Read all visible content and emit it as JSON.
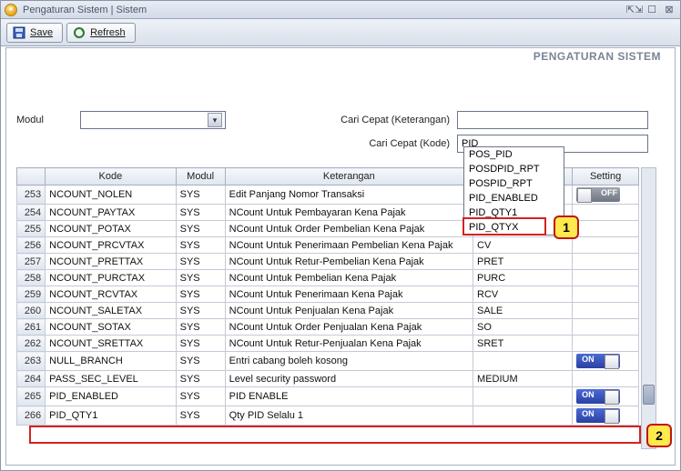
{
  "title": "Pengaturan Sistem | Sistem",
  "toolbar": {
    "save": "Save",
    "refresh": "Refresh"
  },
  "header_label": "PENGATURAN SISTEM",
  "labels": {
    "modul": "Modul",
    "cari_ket": "Cari Cepat (Keterangan)",
    "cari_kode": "Cari Cepat (Kode)"
  },
  "search": {
    "ket_value": "",
    "kode_value": "PID"
  },
  "suggestions": [
    "POS_PID",
    "POSDPID_RPT",
    "POSPID_RPT",
    "PID_ENABLED",
    "PID_QTY1",
    "PID_QTYX"
  ],
  "columns": {
    "c1": "Kode",
    "c2": "Modul",
    "c3": "Keterangan",
    "c4": "",
    "c5": "Setting"
  },
  "rows": [
    {
      "n": "253",
      "kode": "NCOUNT_NOLEN",
      "modul": "SYS",
      "ket": "Edit Panjang Nomor Transaksi",
      "val": "",
      "set": "OFF"
    },
    {
      "n": "254",
      "kode": "NCOUNT_PAYTAX",
      "modul": "SYS",
      "ket": "NCount Untuk Pembayaran Kena Pajak",
      "val": "",
      "set": ""
    },
    {
      "n": "255",
      "kode": "NCOUNT_POTAX",
      "modul": "SYS",
      "ket": "NCount Untuk Order Pembelian Kena Pajak",
      "val": "",
      "set": ""
    },
    {
      "n": "256",
      "kode": "NCOUNT_PRCVTAX",
      "modul": "SYS",
      "ket": "NCount Untuk Penerimaan Pembelian Kena Pajak",
      "val": "CV",
      "set": ""
    },
    {
      "n": "257",
      "kode": "NCOUNT_PRETTAX",
      "modul": "SYS",
      "ket": "NCount Untuk Retur-Pembelian Kena Pajak",
      "val": "PRET",
      "set": ""
    },
    {
      "n": "258",
      "kode": "NCOUNT_PURCTAX",
      "modul": "SYS",
      "ket": "NCount Untuk Pembelian Kena Pajak",
      "val": "PURC",
      "set": ""
    },
    {
      "n": "259",
      "kode": "NCOUNT_RCVTAX",
      "modul": "SYS",
      "ket": "NCount Untuk Penerimaan Kena Pajak",
      "val": "RCV",
      "set": ""
    },
    {
      "n": "260",
      "kode": "NCOUNT_SALETAX",
      "modul": "SYS",
      "ket": "NCount Untuk Penjualan Kena Pajak",
      "val": "SALE",
      "set": ""
    },
    {
      "n": "261",
      "kode": "NCOUNT_SOTAX",
      "modul": "SYS",
      "ket": "NCount Untuk Order Penjualan Kena Pajak",
      "val": "SO",
      "set": ""
    },
    {
      "n": "262",
      "kode": "NCOUNT_SRETTAX",
      "modul": "SYS",
      "ket": "NCount Untuk Retur-Penjualan Kena Pajak",
      "val": "SRET",
      "set": ""
    },
    {
      "n": "263",
      "kode": "NULL_BRANCH",
      "modul": "SYS",
      "ket": "Entri cabang boleh kosong",
      "val": "",
      "set": "ON"
    },
    {
      "n": "264",
      "kode": "PASS_SEC_LEVEL",
      "modul": "SYS",
      "ket": "Level security password",
      "val": "MEDIUM",
      "set": ""
    },
    {
      "n": "265",
      "kode": "PID_ENABLED",
      "modul": "SYS",
      "ket": "PID ENABLE",
      "val": "",
      "set": "ON"
    },
    {
      "n": "266",
      "kode": "PID_QTY1",
      "modul": "SYS",
      "ket": "Qty PID Selalu 1",
      "val": "",
      "set": "ON"
    }
  ],
  "callouts": {
    "c1": "1",
    "c2": "2"
  }
}
